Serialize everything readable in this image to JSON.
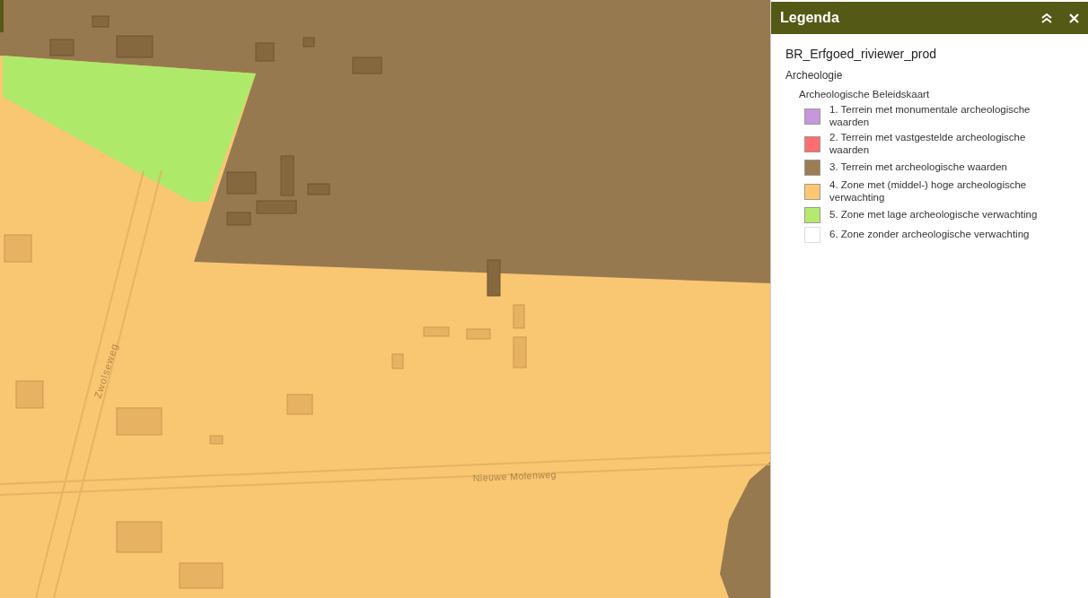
{
  "map": {
    "street_labels": [
      {
        "text": "Zwolseweg",
        "kind": "vertical"
      },
      {
        "text": "Nieuwe Molenweg",
        "kind": "horizontal"
      }
    ]
  },
  "legend": {
    "title": "Legenda",
    "service": "BR_Erfgoed_riviewer_prod",
    "group": "Archeologie",
    "layer": "Archeologische Beleidskaart",
    "items": [
      {
        "label": "1. Terrein met monumentale archeologische waarden",
        "color": "#c896dc"
      },
      {
        "label": "2. Terrein met vastgestelde archeologische waarden",
        "color": "#ff6e6e"
      },
      {
        "label": "3. Terrein met archeologische waarden",
        "color": "#9b7d55"
      },
      {
        "label": "4. Zone met (middel-) hoge archeologische verwachting",
        "color": "#ffc870"
      },
      {
        "label": "5. Zone met lage archeologische verwachting",
        "color": "#b4eb6e"
      },
      {
        "label": "6. Zone zonder archeologische verwachting",
        "color": "#ffffff"
      }
    ]
  }
}
